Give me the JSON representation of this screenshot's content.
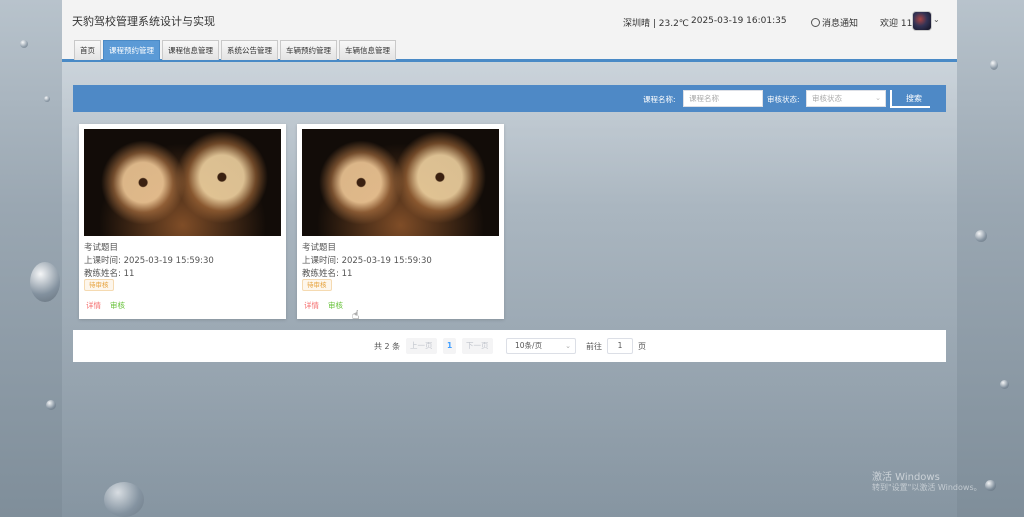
{
  "header": {
    "title": "天豹驾校管理系统设计与实现",
    "weather": "深圳晴 | 23.2℃",
    "datetime": "2025-03-19  16:01:35",
    "notice": "消息通知",
    "welcome": "欢迎 11"
  },
  "tabs": [
    {
      "label": "首页",
      "active": false
    },
    {
      "label": "课程预约管理",
      "active": true
    },
    {
      "label": "课程信息管理",
      "active": false
    },
    {
      "label": "系统公告管理",
      "active": false
    },
    {
      "label": "车辆预约管理",
      "active": false
    },
    {
      "label": "车辆信息管理",
      "active": false
    }
  ],
  "search": {
    "course_label": "课程名称:",
    "course_placeholder": "课程名称",
    "status_label": "审核状态:",
    "status_placeholder": "审核状态",
    "button_label": "搜索"
  },
  "cards": [
    {
      "title": "考试题目",
      "time": "上课时间:  2025-03-19 15:59:30",
      "coach": "教练姓名:  11",
      "status": "待审核",
      "detail": "详情",
      "audit": "审核"
    },
    {
      "title": "考试题目",
      "time": "上课时间:  2025-03-19 15:59:30",
      "coach": "教练姓名:  11",
      "status": "待审核",
      "detail": "详情",
      "audit": "审核"
    }
  ],
  "pagination": {
    "total": "共 2 条",
    "prev": "上一页",
    "current": "1",
    "next": "下一页",
    "page_size": "10条/页",
    "goto": "前往",
    "goto_value": "1",
    "page_suffix": "页"
  },
  "watermark": {
    "line1": "激活 Windows",
    "line2": "转到\"设置\"以激活 Windows。"
  },
  "colors": {
    "accent": "#4e89c6",
    "status_pending": "#e6a23c",
    "link_detail": "#f56c6c",
    "link_audit": "#67c23a"
  }
}
